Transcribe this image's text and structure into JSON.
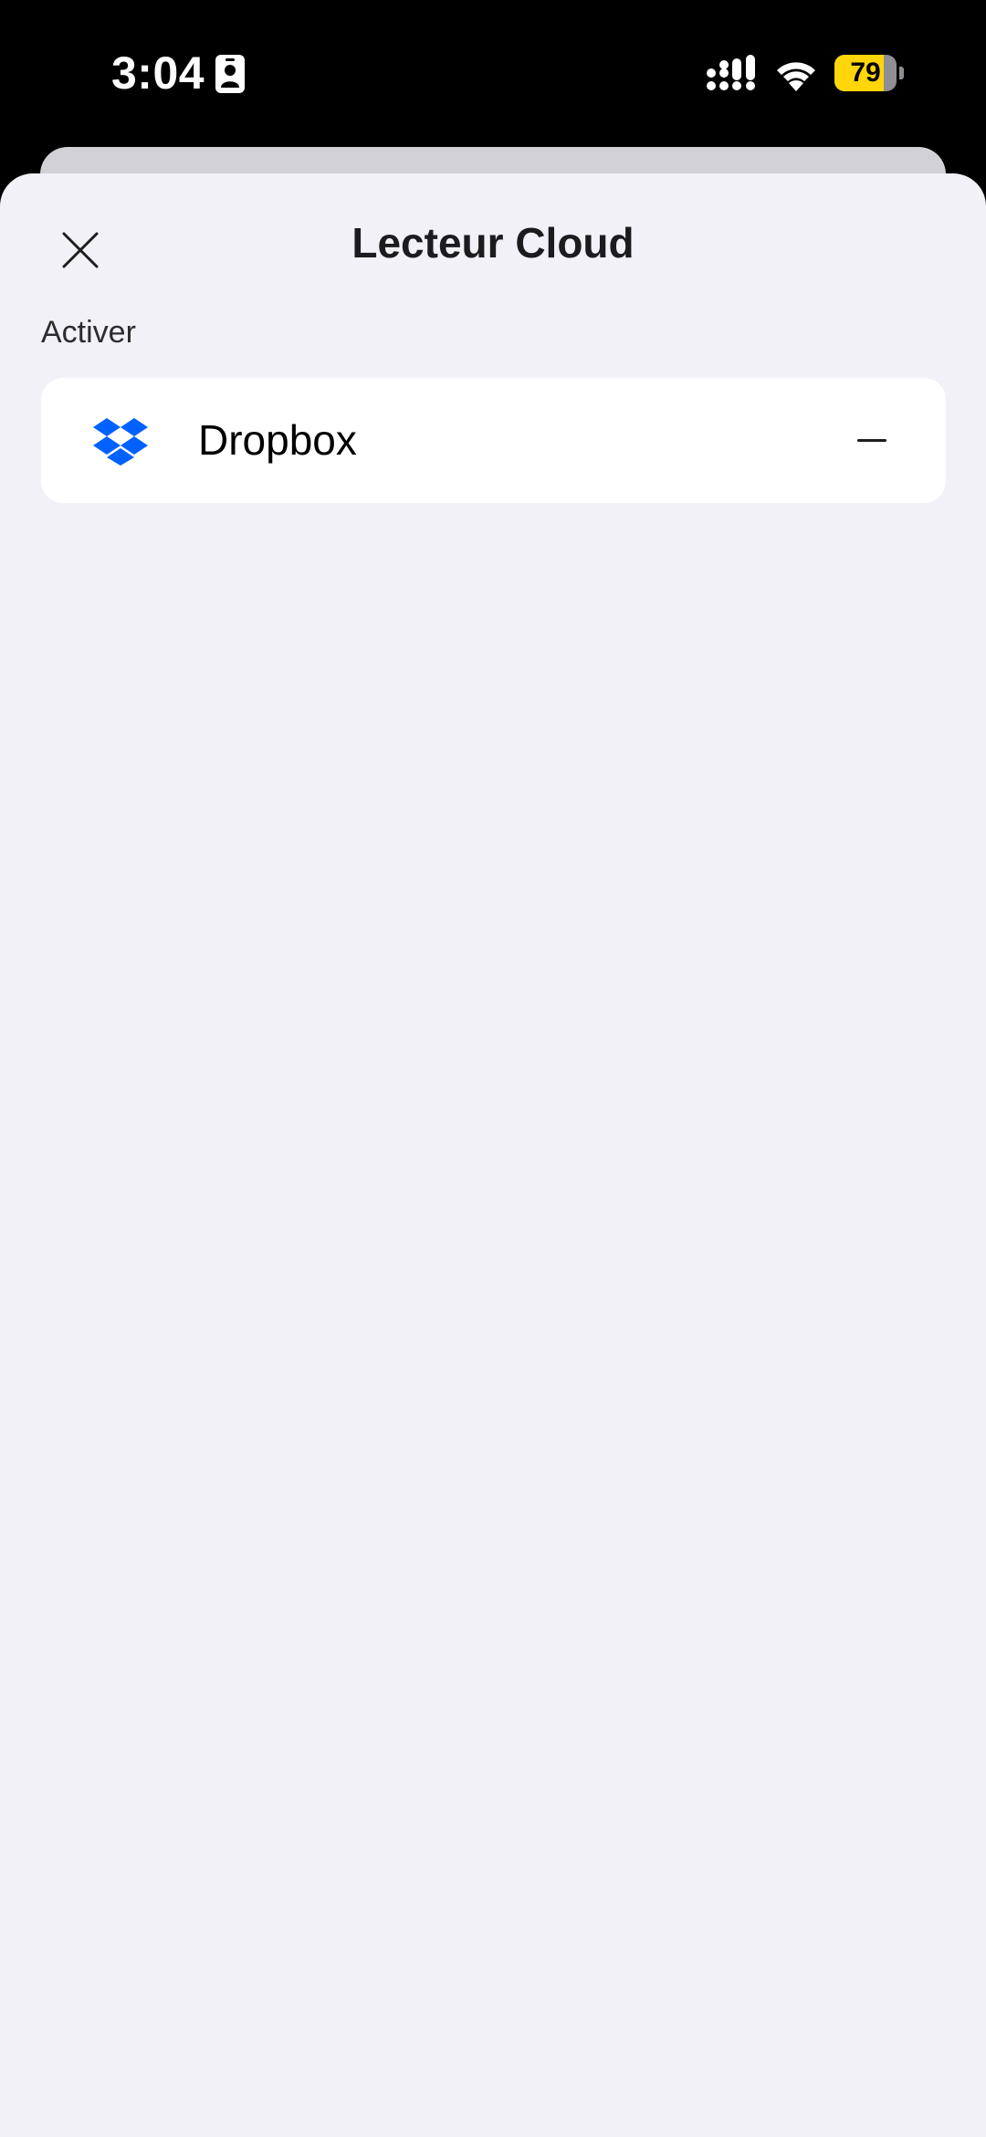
{
  "status_bar": {
    "time": "3:04",
    "battery_level": "79",
    "battery_fraction": 0.79,
    "icons": [
      "contact-card-icon",
      "cellular-signal-icon",
      "wifi-icon",
      "battery-icon"
    ]
  },
  "sheet": {
    "title": "Lecteur Cloud",
    "close_icon": "close-icon"
  },
  "section": {
    "header": "Activer",
    "items": [
      {
        "label": "Dropbox",
        "icon": "dropbox-icon",
        "icon_color": "#0061fe",
        "action_icon": "minus-icon"
      }
    ]
  },
  "colors": {
    "background": "#f2f1f7",
    "card": "#ffffff",
    "battery_fill": "#ffd60a",
    "dropbox_blue": "#0061fe"
  }
}
